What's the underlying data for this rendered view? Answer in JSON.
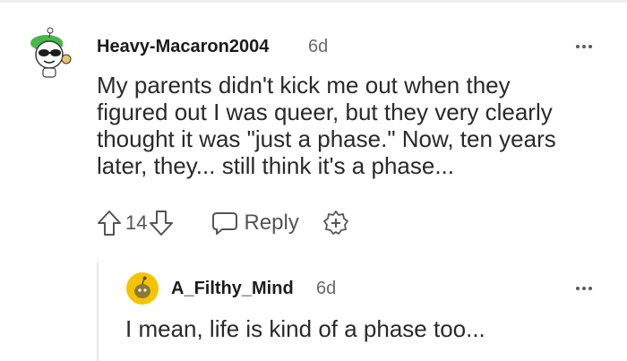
{
  "comment": {
    "username": "Heavy-Macaron2004",
    "age": "6d",
    "body_lines": [
      "My parents didn't kick me out when they",
      "figured out I was queer, but they very clearly",
      "thought it was \"just a phase.\" Now, ten years",
      "later, they... still think it's a phase..."
    ],
    "vote_count": "14",
    "reply_label": "Reply",
    "icons": {
      "avatar": "snoo-avatar-sunglasses-icon",
      "upvote": "upvote-arrow-icon",
      "downvote": "downvote-arrow-icon",
      "reply": "chat-bubble-icon",
      "award": "award-plus-icon",
      "more": "more-options-icon"
    }
  },
  "reply": {
    "username": "A_Filthy_Mind",
    "age": "6d",
    "body": "I mean, life is kind of a phase too...",
    "icons": {
      "avatar": "snoo-avatar-yellow-icon",
      "more": "more-options-icon"
    }
  },
  "colors": {
    "text": "#1c1c1c",
    "meta": "#6a6a6a",
    "avatar_green": "#46b84a",
    "avatar_yellow": "#f5c400",
    "thread_line": "#e5e7ea"
  }
}
